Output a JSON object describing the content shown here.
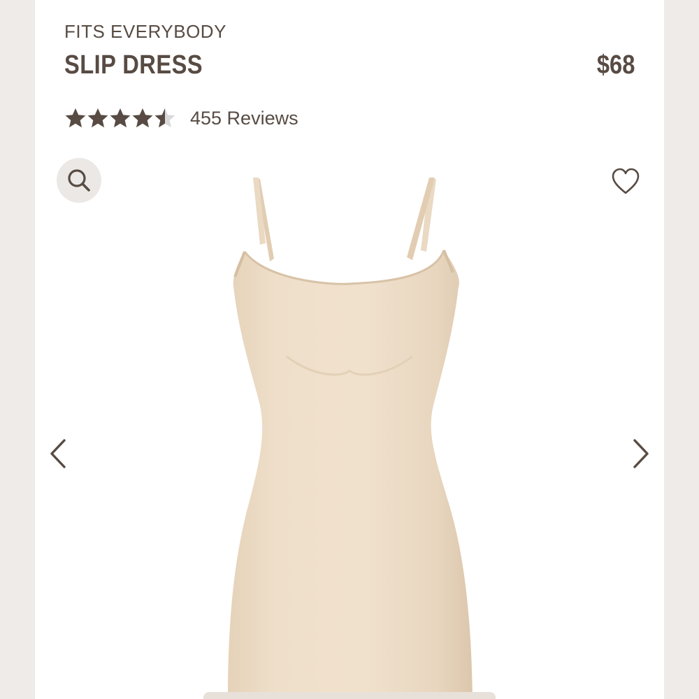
{
  "product": {
    "collection": "FITS EVERYBODY",
    "name": "SLIP DRESS",
    "price": "$68",
    "rating": 4.5,
    "reviews_label": "455 Reviews"
  },
  "icons": {
    "zoom": "search-icon",
    "wishlist": "heart-icon",
    "prev": "chevron-left-icon",
    "next": "chevron-right-icon"
  },
  "colors": {
    "text": "#574b43",
    "star_filled": "#574b43",
    "star_empty": "#d9d9d9",
    "dress": "#ecdcc6",
    "page_bg": "#efebe8"
  }
}
